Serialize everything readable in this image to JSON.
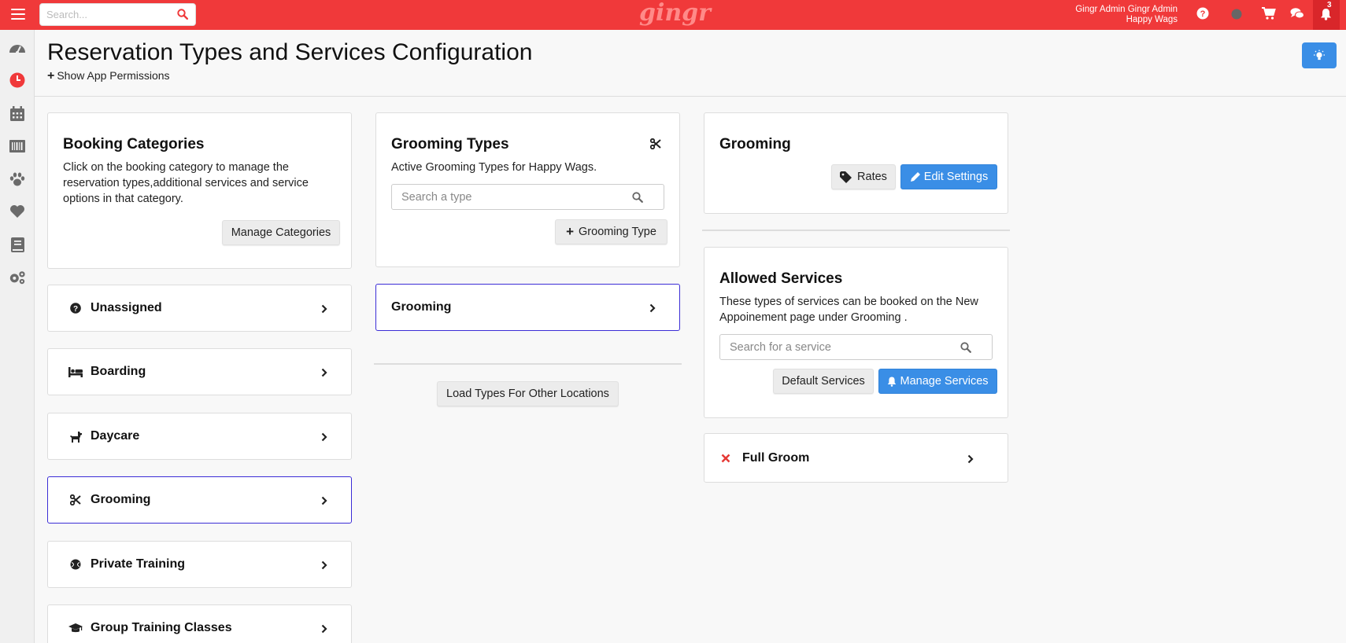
{
  "topbar": {
    "search_placeholder": "Search...",
    "logo": "gingr",
    "user_name": "Gingr Admin Gingr Admin",
    "location": "Happy Wags",
    "notification_count": "3"
  },
  "page": {
    "title": "Reservation Types and Services Configuration",
    "permissions_link": "Show App Permissions"
  },
  "booking_categories": {
    "title": "Booking Categories",
    "description": "Click on the booking category to manage the reservation types,additional services and service options in that category.",
    "manage_button": "Manage Categories",
    "items": [
      {
        "label": "Unassigned",
        "icon": "question-circle-icon"
      },
      {
        "label": "Boarding",
        "icon": "bed-icon"
      },
      {
        "label": "Daycare",
        "icon": "dog-icon"
      },
      {
        "label": "Grooming",
        "icon": "scissors-icon",
        "active": true
      },
      {
        "label": "Private Training",
        "icon": "ball-icon"
      },
      {
        "label": "Group Training Classes",
        "icon": "graduation-cap-icon"
      }
    ]
  },
  "grooming_types": {
    "title": "Grooming Types",
    "subtitle": "Active Grooming Types for Happy Wags.",
    "search_placeholder": "Search a type",
    "add_button": "Grooming Type",
    "items": [
      "Grooming"
    ],
    "load_other_button": "Load Types For Other Locations"
  },
  "type_detail": {
    "title": "Grooming",
    "rates_button": "Rates",
    "edit_button": "Edit Settings"
  },
  "allowed_services": {
    "title": "Allowed Services",
    "description": "These types of services can be booked on the New Appoinement page under Grooming .",
    "search_placeholder": "Search for a service",
    "default_button": "Default Services",
    "manage_button": "Manage Services",
    "items": [
      {
        "label": "Full Groom",
        "status": "disallowed"
      }
    ]
  },
  "colors": {
    "brand_red": "#f0393a",
    "accent_blue": "#3a8ee6",
    "active_border": "#3b2dd6",
    "remove_red": "#e53935"
  }
}
